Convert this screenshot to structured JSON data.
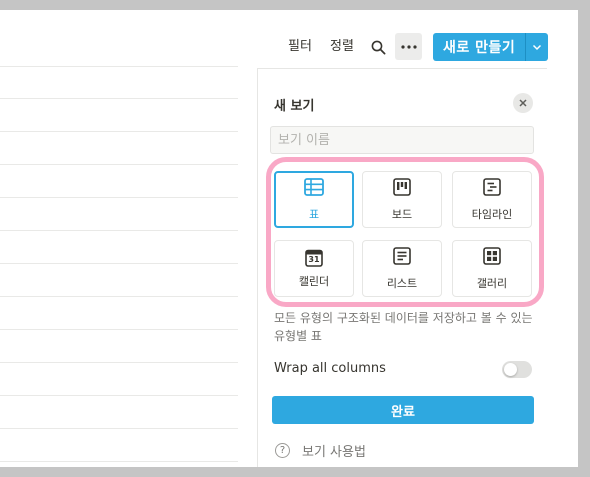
{
  "toolbar": {
    "filter_label": "필터",
    "sort_label": "정렬",
    "search_icon": "search-icon",
    "more_icon": "more-horizontal-icon",
    "new_button_label": "새로 만들기",
    "new_dropdown_icon": "chevron-down-icon"
  },
  "panel": {
    "title": "새 보기",
    "close_icon": "close-icon",
    "name_placeholder": "보기 이름",
    "types": [
      {
        "label": "표",
        "icon": "table-icon",
        "selected": true
      },
      {
        "label": "보드",
        "icon": "board-icon",
        "selected": false
      },
      {
        "label": "타임라인",
        "icon": "timeline-icon",
        "selected": false
      },
      {
        "label": "캘린더",
        "icon": "calendar-icon",
        "selected": false
      },
      {
        "label": "리스트",
        "icon": "list-icon",
        "selected": false
      },
      {
        "label": "갤러리",
        "icon": "gallery-icon",
        "selected": false
      }
    ],
    "calendar_day": "31",
    "description": "모든 유형의 구조화된 데이터를 저장하고 볼 수 있는 유형별 표",
    "wrap_label": "Wrap all columns",
    "wrap_enabled": false,
    "done_label": "완료",
    "help_symbol": "?",
    "help_label": "보기 사용법"
  },
  "colors": {
    "accent": "#2ea8e0",
    "highlight": "#f9a8c6"
  }
}
